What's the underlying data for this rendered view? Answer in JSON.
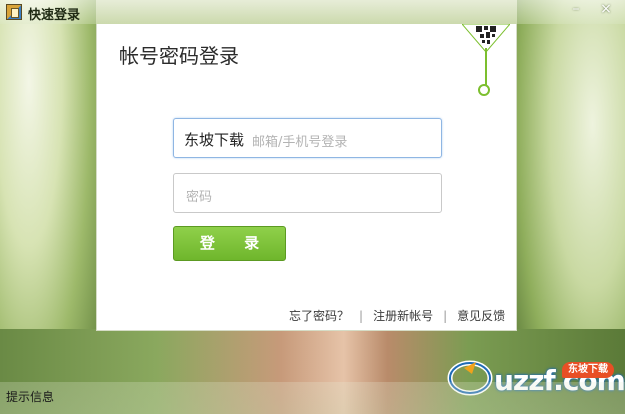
{
  "window": {
    "title": "快速登录",
    "minimize_label": "–",
    "close_label": "×"
  },
  "login": {
    "heading": "帐号密码登录",
    "username_value": "东坡下载",
    "username_hint": "邮箱/手机号登录",
    "password_placeholder": "密码",
    "login_button": "登 录"
  },
  "links": {
    "forgot_password": "忘了密码？",
    "register": "注册新帐号",
    "feedback": "意见反馈",
    "separator": "|"
  },
  "watermark": {
    "logo_text": "uzzf.com",
    "badge_text": "东坡下载"
  },
  "status": {
    "text": "提示信息"
  },
  "colors": {
    "accent_green": "#7cbf2e",
    "button_green": "#6fb62c",
    "input_focus": "#8fb6e3"
  }
}
